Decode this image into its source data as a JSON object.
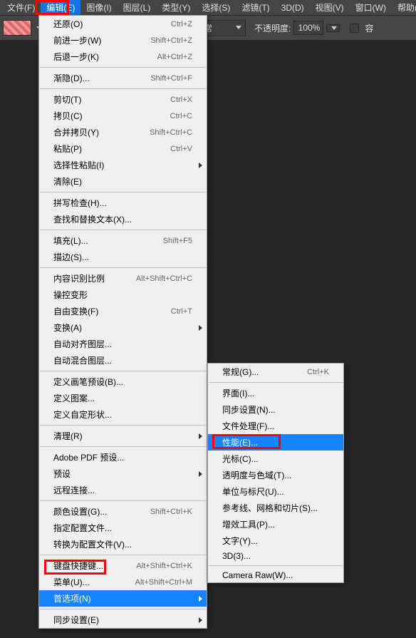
{
  "menubar": [
    {
      "label": "文件(F)"
    },
    {
      "label": "编辑(E)"
    },
    {
      "label": "图像(I)"
    },
    {
      "label": "图层(L)"
    },
    {
      "label": "类型(Y)"
    },
    {
      "label": "选择(S)"
    },
    {
      "label": "滤镜(T)"
    },
    {
      "label": "3D(D)"
    },
    {
      "label": "视图(V)"
    },
    {
      "label": "窗口(W)"
    },
    {
      "label": "帮助(H"
    }
  ],
  "options": {
    "blend_mode": "正常",
    "opacity_label": "不透明度:",
    "opacity_value": "100%",
    "flow_label": "容"
  },
  "edit_menu": [
    {
      "t": "i",
      "label": "还原(O)",
      "sc": "Ctrl+Z"
    },
    {
      "t": "i",
      "label": "前进一步(W)",
      "sc": "Shift+Ctrl+Z"
    },
    {
      "t": "i",
      "label": "后退一步(K)",
      "sc": "Alt+Ctrl+Z"
    },
    {
      "t": "s"
    },
    {
      "t": "i",
      "label": "渐隐(D)...",
      "sc": "Shift+Ctrl+F"
    },
    {
      "t": "s"
    },
    {
      "t": "i",
      "label": "剪切(T)",
      "sc": "Ctrl+X"
    },
    {
      "t": "i",
      "label": "拷贝(C)",
      "sc": "Ctrl+C"
    },
    {
      "t": "i",
      "label": "合并拷贝(Y)",
      "sc": "Shift+Ctrl+C"
    },
    {
      "t": "i",
      "label": "粘贴(P)",
      "sc": "Ctrl+V"
    },
    {
      "t": "i",
      "label": "选择性粘贴(I)",
      "sub": true
    },
    {
      "t": "i",
      "label": "清除(E)"
    },
    {
      "t": "s"
    },
    {
      "t": "i",
      "label": "拼写检查(H)..."
    },
    {
      "t": "i",
      "label": "查找和替换文本(X)..."
    },
    {
      "t": "s"
    },
    {
      "t": "i",
      "label": "填充(L)...",
      "sc": "Shift+F5"
    },
    {
      "t": "i",
      "label": "描边(S)..."
    },
    {
      "t": "s"
    },
    {
      "t": "i",
      "label": "内容识别比例",
      "sc": "Alt+Shift+Ctrl+C"
    },
    {
      "t": "i",
      "label": "操控变形"
    },
    {
      "t": "i",
      "label": "自由变换(F)",
      "sc": "Ctrl+T"
    },
    {
      "t": "i",
      "label": "变换(A)",
      "sub": true
    },
    {
      "t": "i",
      "label": "自动对齐图层..."
    },
    {
      "t": "i",
      "label": "自动混合图层..."
    },
    {
      "t": "s"
    },
    {
      "t": "i",
      "label": "定义画笔预设(B)..."
    },
    {
      "t": "i",
      "label": "定义图案..."
    },
    {
      "t": "i",
      "label": "定义自定形状..."
    },
    {
      "t": "s"
    },
    {
      "t": "i",
      "label": "清理(R)",
      "sub": true
    },
    {
      "t": "s"
    },
    {
      "t": "i",
      "label": "Adobe PDF 预设..."
    },
    {
      "t": "i",
      "label": "预设",
      "sub": true
    },
    {
      "t": "i",
      "label": "远程连接..."
    },
    {
      "t": "s"
    },
    {
      "t": "i",
      "label": "颜色设置(G)...",
      "sc": "Shift+Ctrl+K"
    },
    {
      "t": "i",
      "label": "指定配置文件..."
    },
    {
      "t": "i",
      "label": "转换为配置文件(V)..."
    },
    {
      "t": "s"
    },
    {
      "t": "i",
      "label": "键盘快捷键...",
      "sc": "Alt+Shift+Ctrl+K"
    },
    {
      "t": "i",
      "label": "菜单(U)...",
      "sc": "Alt+Shift+Ctrl+M"
    },
    {
      "t": "i",
      "label": "首选项(N)",
      "sub": true,
      "sel": true
    },
    {
      "t": "s"
    },
    {
      "t": "i",
      "label": "同步设置(E)",
      "sub": true
    }
  ],
  "pref_menu": [
    {
      "t": "i",
      "label": "常规(G)...",
      "sc": "Ctrl+K"
    },
    {
      "t": "s"
    },
    {
      "t": "i",
      "label": "界面(I)..."
    },
    {
      "t": "i",
      "label": "同步设置(N)..."
    },
    {
      "t": "i",
      "label": "文件处理(F)..."
    },
    {
      "t": "i",
      "label": "性能(E)...",
      "sel": true
    },
    {
      "t": "i",
      "label": "光标(C)..."
    },
    {
      "t": "i",
      "label": "透明度与色域(T)..."
    },
    {
      "t": "i",
      "label": "单位与标尺(U)..."
    },
    {
      "t": "i",
      "label": "参考线、网格和切片(S)..."
    },
    {
      "t": "i",
      "label": "增效工具(P)..."
    },
    {
      "t": "i",
      "label": "文字(Y)..."
    },
    {
      "t": "i",
      "label": "3D(3)..."
    },
    {
      "t": "s"
    },
    {
      "t": "i",
      "label": "Camera Raw(W)..."
    }
  ]
}
